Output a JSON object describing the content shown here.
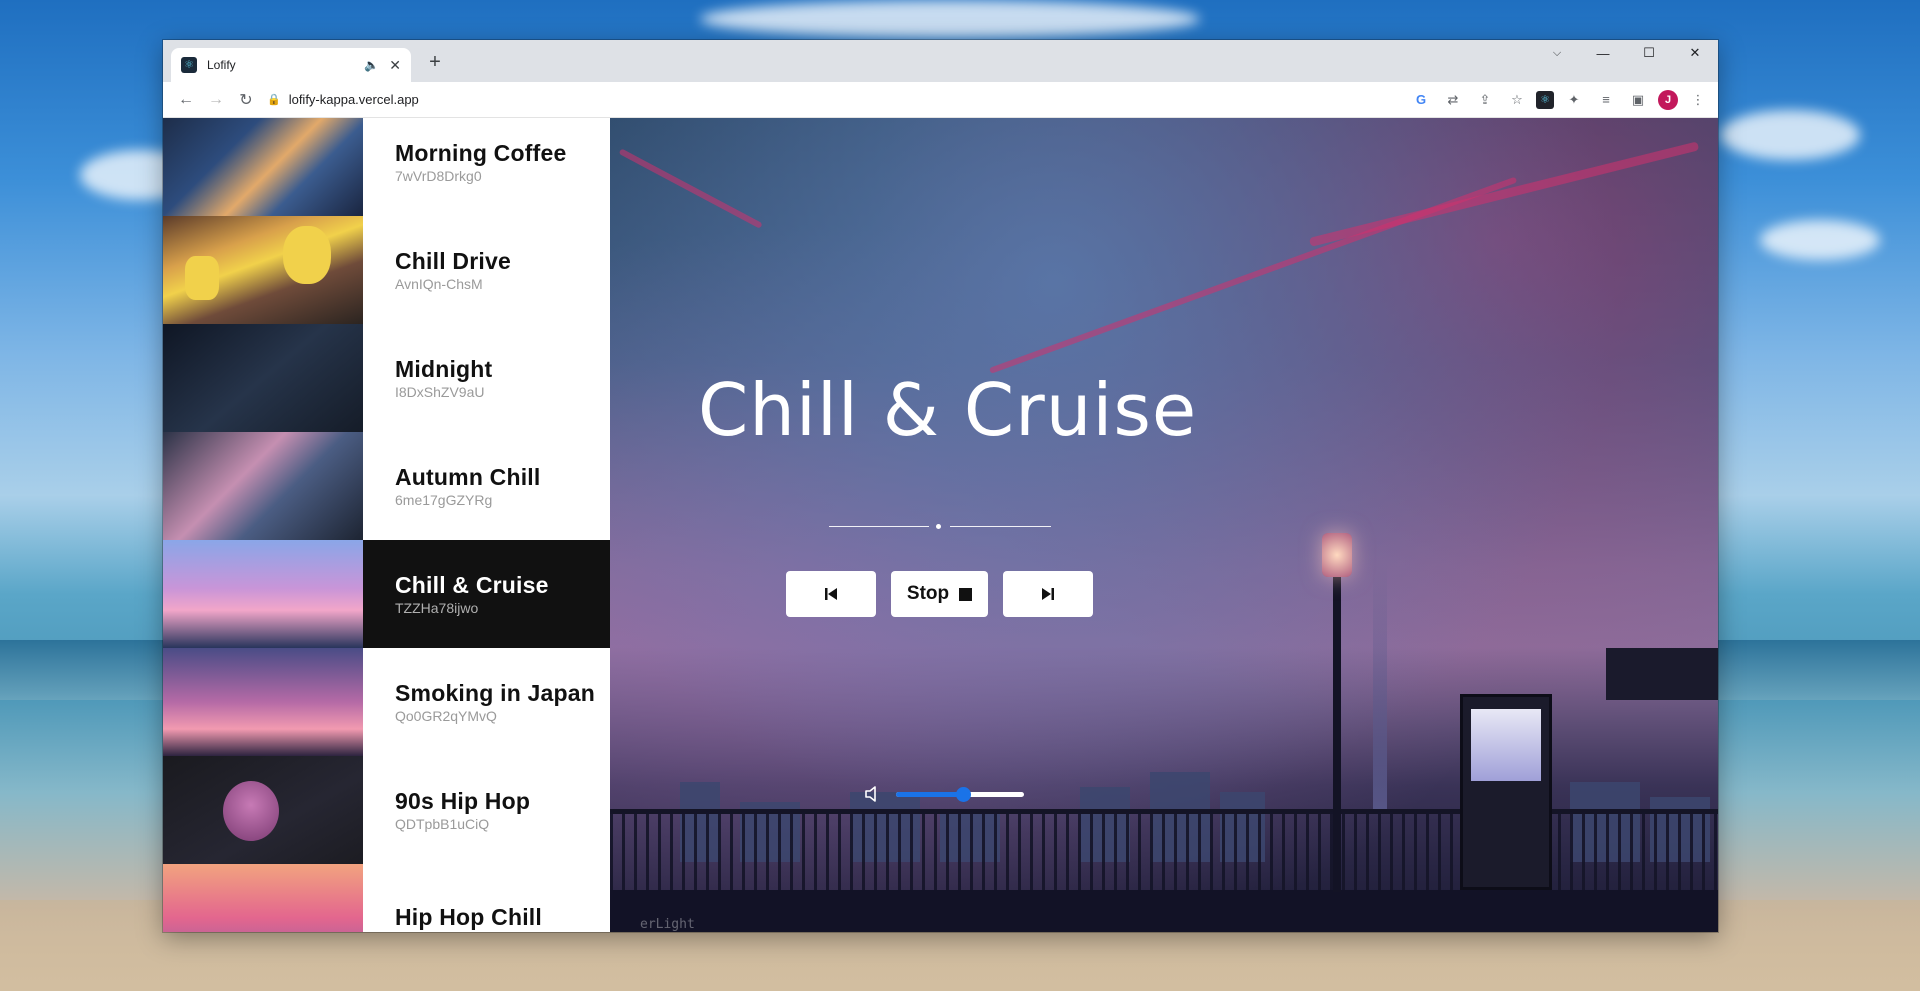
{
  "browser": {
    "tab_title": "Lofify",
    "tab_audio_icon": "speaker-icon",
    "url": "lofify-kappa.vercel.app"
  },
  "sidebar": {
    "stations": [
      {
        "name": "Morning Coffee",
        "id": "7wVrD8Drkg0",
        "active": false
      },
      {
        "name": "Chill Drive",
        "id": "AvnIQn-ChsM",
        "active": false
      },
      {
        "name": "Midnight",
        "id": "I8DxShZV9aU",
        "active": false
      },
      {
        "name": "Autumn Chill",
        "id": "6me17gGZYRg",
        "active": false
      },
      {
        "name": "Chill & Cruise",
        "id": "TZZHa78ijwo",
        "active": true
      },
      {
        "name": "Smoking in Japan",
        "id": "Qo0GR2qYMvQ",
        "active": false
      },
      {
        "name": "90s Hip Hop",
        "id": "QDTpbB1uCiQ",
        "active": false
      },
      {
        "name": "Hip Hop Chill",
        "id": "",
        "active": false
      }
    ]
  },
  "player": {
    "title": "Chill & Cruise",
    "stop_label": "Stop",
    "volume_fraction": 0.52,
    "watermark": "erLight"
  },
  "colors": {
    "accent": "#1a73e8",
    "active_bg": "#111111"
  }
}
